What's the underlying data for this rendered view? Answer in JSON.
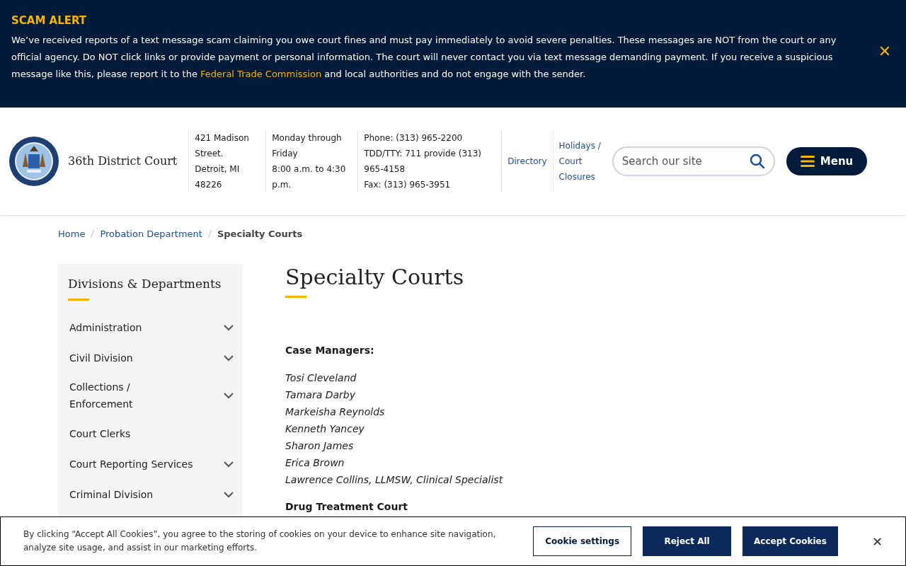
{
  "alert": {
    "title": "SCAM ALERT",
    "message": "We’ve received reports of a text message scam claiming you owe court fines and must pay immediately to avoid severe penalties. These messages are NOT from the court or any official agency. Do NOT click links or provide payment or personal information. The court will never contact you via text message demanding payment. If you receive a suspicious message like this, please report it to the ",
    "link": "Federal Trade Commission",
    "message_end": " and local authorities and do not engage with the sender.",
    "close": "✕"
  },
  "header": {
    "site_name": "36th District Court",
    "info": [
      [
        "421 Madison",
        "Street.",
        "Detroit, MI",
        "48226"
      ],
      [
        "Monday through",
        "Friday",
        "8:00 a.m. to 4:30",
        "p.m."
      ],
      [
        "Phone: (313) 965-2200",
        "TDD/TTY: 711 provide (313)",
        "965-4158",
        "Fax: (313) 965-3951"
      ]
    ],
    "links": [
      [
        "Directory"
      ],
      [
        "Holidays /",
        "Court",
        "Closures"
      ]
    ],
    "search": {
      "placeholder": "Search our site"
    },
    "menu": "Menu"
  },
  "breadcrumb": [
    {
      "label": "Home",
      "current": false
    },
    {
      "label": "Probation Department",
      "current": false
    },
    {
      "label": "Specialty Courts",
      "current": true
    }
  ],
  "sidebar": {
    "title": "Divisions & Departments",
    "items": [
      {
        "label": "Administration",
        "expandable": true
      },
      {
        "label": "Civil Division",
        "expandable": true
      },
      {
        "label": "Collections /\nEnforcement",
        "expandable": true
      },
      {
        "label": "Court Clerks",
        "expandable": false
      },
      {
        "label": "Court Reporting Services",
        "expandable": true
      },
      {
        "label": "Criminal Division",
        "expandable": true
      }
    ]
  },
  "content": {
    "title": "Specialty Courts",
    "blocks": [
      {
        "kind": "heading",
        "text": "Case Managers:"
      },
      {
        "kind": "names",
        "lines": [
          "Tosi Cleveland",
          "Tamara Darby",
          "Markeisha Reynolds",
          "Kenneth Yancey",
          "Sharon James",
          "Erica Brown",
          "Lawrence Collins, LLMSW, Clinical Specialist"
        ]
      },
      {
        "kind": "heading",
        "text": "Drug Treatment Court"
      }
    ]
  },
  "cookies": {
    "text": "By clicking “Accept All Cookies”, you agree to the storing of cookies on your device to enhance site navigation, analyze site usage, and assist in our marketing efforts.",
    "buttons": [
      {
        "label": "Cookie settings",
        "kind": "outline"
      },
      {
        "label": "Reject All",
        "kind": "solid"
      },
      {
        "label": "Accept Cookies",
        "kind": "solid"
      }
    ],
    "close": "✕"
  }
}
